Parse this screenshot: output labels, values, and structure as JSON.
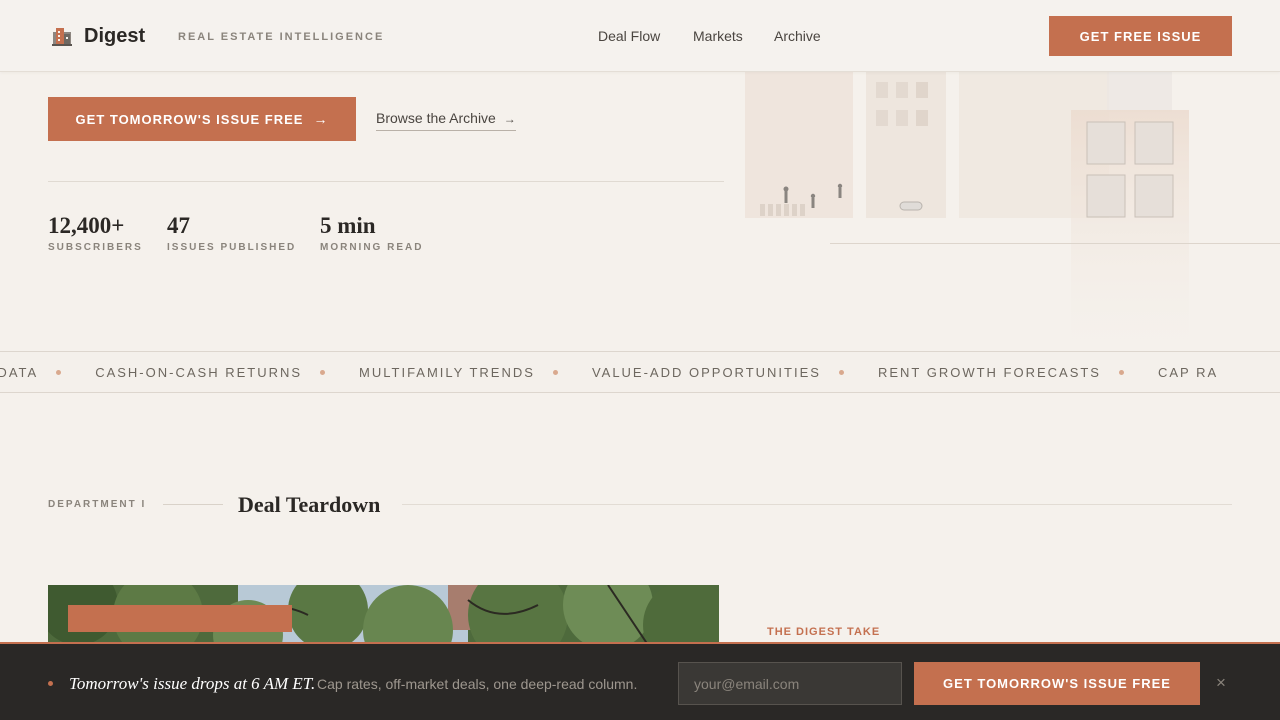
{
  "header": {
    "brand": "Digest",
    "tagline": "REAL ESTATE INTELLIGENCE",
    "nav": [
      "Deal Flow",
      "Markets",
      "Archive"
    ],
    "cta": "GET FREE ISSUE"
  },
  "hero": {
    "cta": "GET TOMORROW'S ISSUE FREE",
    "cta_arrow": "→",
    "browse": "Browse the Archive",
    "browse_arrow": "→",
    "stats": [
      {
        "value": "12,400+",
        "label": "SUBSCRIBERS"
      },
      {
        "value": "47",
        "label": "ISSUES PUBLISHED"
      },
      {
        "value": "5 min",
        "label": "MORNING READ"
      }
    ]
  },
  "ticker": [
    "CY DATA",
    "CASH-ON-CASH RETURNS",
    "MULTIFAMILY TRENDS",
    "VALUE-ADD OPPORTUNITIES",
    "RENT GROWTH FORECASTS",
    "CAP RA"
  ],
  "section": {
    "department": "DEPARTMENT I",
    "title": "Deal Teardown",
    "digest_take": "THE DIGEST TAKE"
  },
  "bottom_bar": {
    "headline": "Tomorrow's issue drops at 6 AM ET.",
    "subtext": "Cap rates, off-market deals, one deep-read column.",
    "email_placeholder": "your@email.com",
    "cta": "GET TOMORROW'S ISSUE FREE",
    "close": "×"
  },
  "colors": {
    "accent": "#c4704f",
    "background": "#f5f1ec",
    "bar": "#2a2826"
  }
}
